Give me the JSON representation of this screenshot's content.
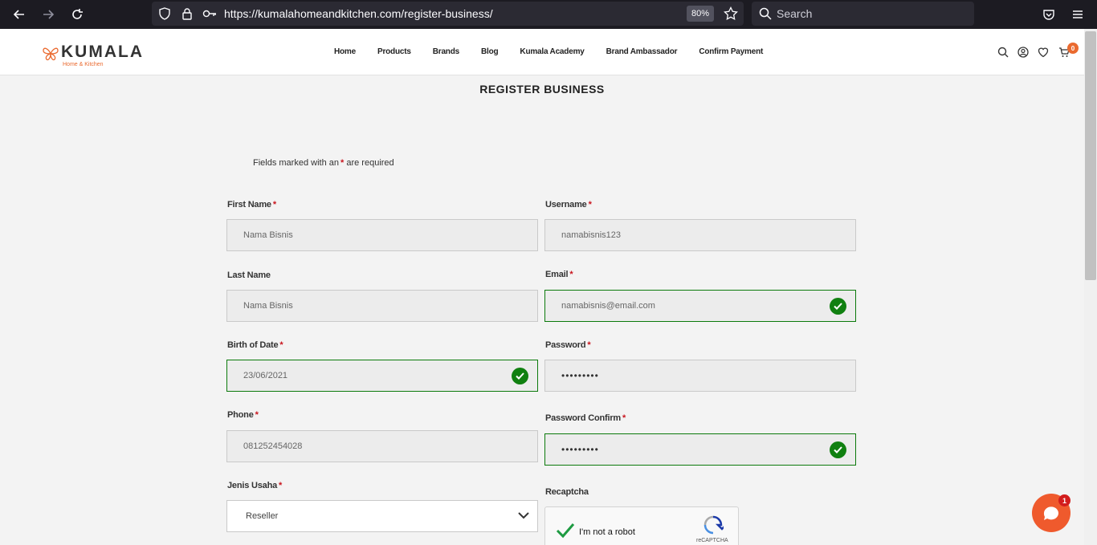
{
  "browser": {
    "url": "https://kumalahomeandkitchen.com/register-business/",
    "zoom": "80%",
    "search_placeholder": "Search"
  },
  "site": {
    "logo_text": "KUMALA",
    "logo_subtitle": "Home & Kitchen",
    "nav": [
      "Home",
      "Products",
      "Brands",
      "Blog",
      "Kumala Academy",
      "Brand Ambassador",
      "Confirm Payment"
    ],
    "cart_count": "0",
    "accent_color": "#ea6a2f"
  },
  "form": {
    "title": "REGISTER BUSINESS",
    "required_note_prefix": "Fields marked with an",
    "required_note_suffix": "are required",
    "required_mark": "*",
    "first_name": {
      "label": "First Name",
      "value": "Nama Bisnis"
    },
    "last_name": {
      "label": "Last Name",
      "value": "Nama Bisnis"
    },
    "birth_date": {
      "label": "Birth of Date",
      "value": "23/06/2021"
    },
    "phone": {
      "label": "Phone",
      "value": "081252454028"
    },
    "business_type": {
      "label": "Jenis Usaha",
      "value": "Reseller"
    },
    "username": {
      "label": "Username",
      "value": "namabisnis123"
    },
    "email": {
      "label": "Email",
      "value": "namabisnis@email.com"
    },
    "password": {
      "label": "Password",
      "value": "•••••••••"
    },
    "password_confirm": {
      "label": "Password Confirm",
      "value": "•••••••••"
    },
    "recaptcha": {
      "label": "Recaptcha",
      "checkbox_text": "I'm not a robot",
      "brand": "reCAPTCHA"
    },
    "valid_color": "#108010"
  },
  "chat": {
    "badge": "1"
  }
}
